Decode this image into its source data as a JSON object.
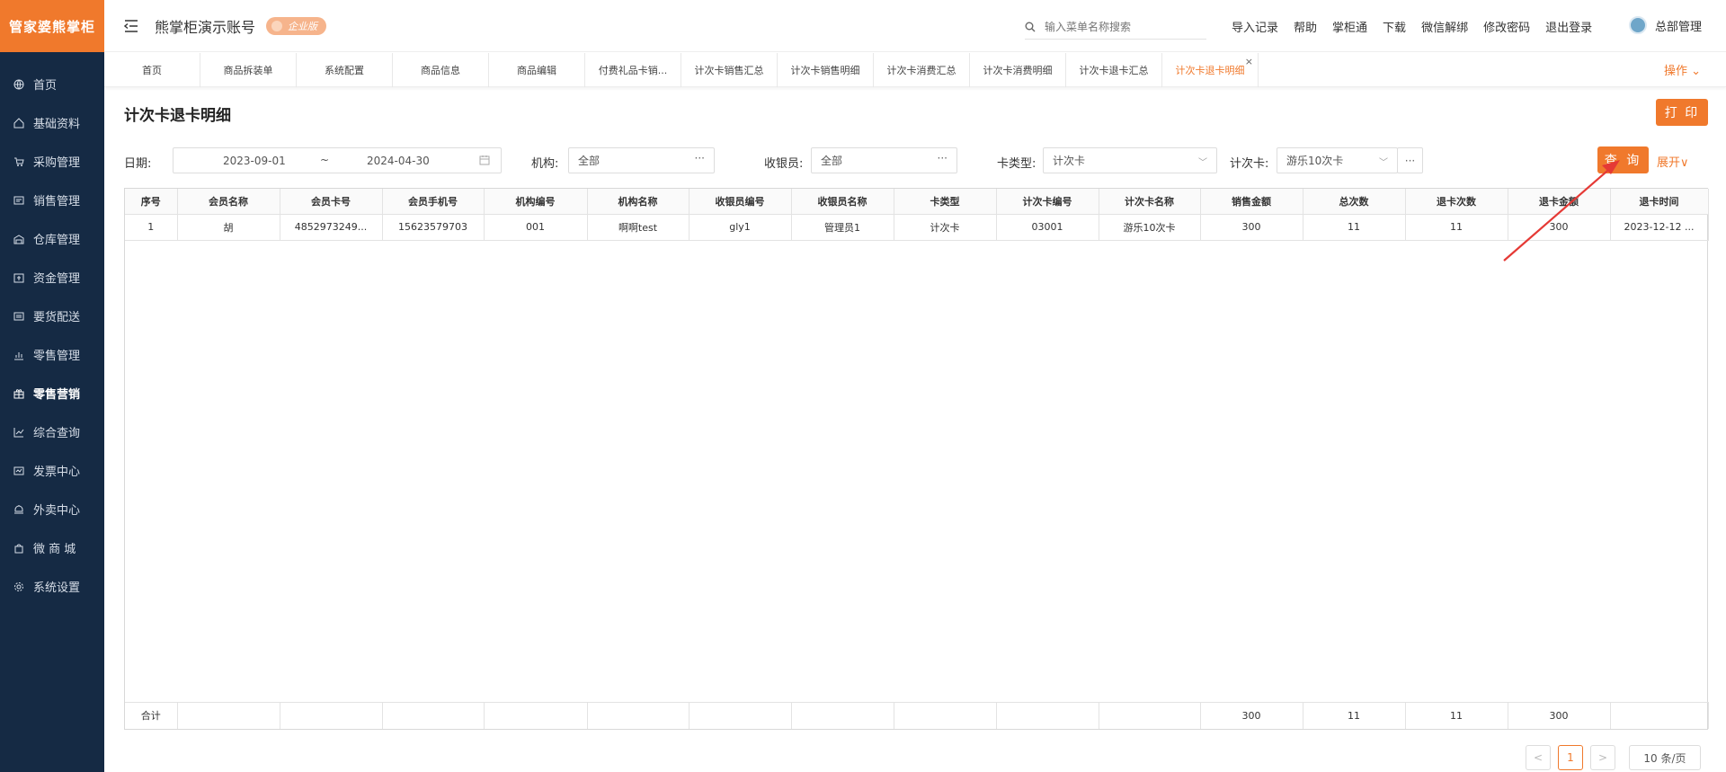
{
  "logo": {
    "text": "管家婆熊掌柜"
  },
  "sidebar": {
    "items": [
      {
        "label": "首页",
        "icon": "globe-icon"
      },
      {
        "label": "基础资料",
        "icon": "home-icon"
      },
      {
        "label": "采购管理",
        "icon": "cart-icon"
      },
      {
        "label": "销售管理",
        "icon": "invoice-icon"
      },
      {
        "label": "仓库管理",
        "icon": "warehouse-icon"
      },
      {
        "label": "资金管理",
        "icon": "money-icon"
      },
      {
        "label": "要货配送",
        "icon": "delivery-icon"
      },
      {
        "label": "零售管理",
        "icon": "retail-chart-icon"
      },
      {
        "label": "零售营销",
        "icon": "gift-icon",
        "active": true
      },
      {
        "label": "综合查询",
        "icon": "query-chart-icon"
      },
      {
        "label": "发票中心",
        "icon": "receipt-icon"
      },
      {
        "label": "外卖中心",
        "icon": "takeout-icon"
      },
      {
        "label": "微 商 城",
        "icon": "shop-bag-icon"
      },
      {
        "label": "系统设置",
        "icon": "gear-icon"
      }
    ]
  },
  "header": {
    "account_name": "熊掌柜演示账号",
    "badge": "企业版",
    "search_placeholder": "输入菜单名称搜索",
    "links": [
      "导入记录",
      "帮助",
      "掌柜通",
      "下载",
      "微信解绑",
      "修改密码",
      "退出登录"
    ],
    "user": "总部管理"
  },
  "tabs": {
    "items": [
      "首页",
      "商品拆装单",
      "系统配置",
      "商品信息",
      "商品编辑",
      "付费礼品卡销...",
      "计次卡销售汇总",
      "计次卡销售明细",
      "计次卡消费汇总",
      "计次卡消费明细",
      "计次卡退卡汇总",
      "计次卡退卡明细"
    ],
    "active_index": 11,
    "ops_label": "操作"
  },
  "page": {
    "title": "计次卡退卡明细",
    "print_label": "打 印"
  },
  "filters": {
    "date_label": "日期:",
    "date_from": "2023-09-01",
    "date_sep": "~",
    "date_to": "2024-04-30",
    "org_label": "机构:",
    "org_value": "全部",
    "cashier_label": "收银员:",
    "cashier_value": "全部",
    "card_type_label": "卡类型:",
    "card_type_value": "计次卡",
    "card_label": "计次卡:",
    "card_value": "游乐10次卡",
    "query_label": "查 询",
    "expand_label": "展开"
  },
  "table": {
    "headers": [
      "序号",
      "会员名称",
      "会员卡号",
      "会员手机号",
      "机构编号",
      "机构名称",
      "收银员编号",
      "收银员名称",
      "卡类型",
      "计次卡编号",
      "计次卡名称",
      "销售金额",
      "总次数",
      "退卡次数",
      "退卡金额",
      "退卡时间"
    ],
    "rows": [
      [
        "1",
        "胡",
        "4852973249...",
        "15623579703",
        "001",
        "啊啊test",
        "gly1",
        "管理员1",
        "计次卡",
        "03001",
        "游乐10次卡",
        "300",
        "11",
        "11",
        "300",
        "2023-12-12 ..."
      ]
    ],
    "footer": [
      "合计",
      "",
      "",
      "",
      "",
      "",
      "",
      "",
      "",
      "",
      "",
      "300",
      "11",
      "11",
      "300",
      ""
    ]
  },
  "pagination": {
    "prev": "<",
    "current": "1",
    "next": ">",
    "page_size": "10 条/页"
  },
  "colors": {
    "accent": "#f0792c",
    "sidebar_bg": "#152a44",
    "annotation": "#e53935"
  }
}
